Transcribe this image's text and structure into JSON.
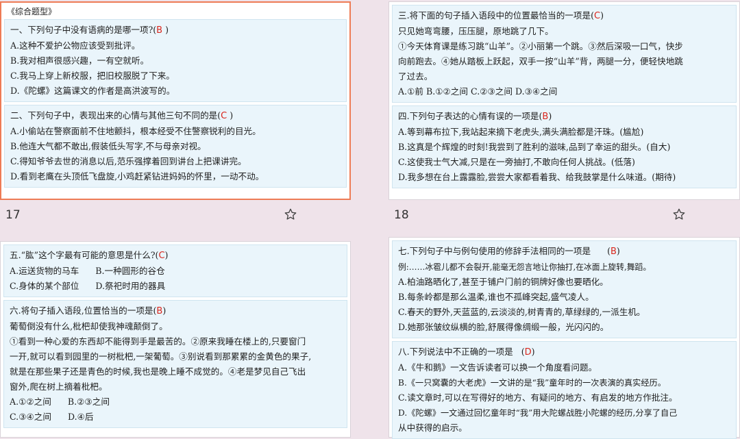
{
  "card17": {
    "tag": "《综合题型》",
    "q1": {
      "stem": "一、下列句子中没有语病的是哪一项?(",
      "answer": "B",
      "close": " )",
      "options": [
        "A.这种不爱护公物应该受到批评。",
        "B.我对相声很感兴趣，一有空就听。",
        "C.我马上穿上新校服，把旧校服脱了下来。",
        "D.《陀螺》这篇课文的作者是高洪波写的。"
      ]
    },
    "q2": {
      "stem": "二、下列句子中，表现出来的心情与其他三句不同的是(",
      "answer": "C",
      "close": " )",
      "options": [
        "A.小偷站在警察面前不住地颤抖，根本经受不住警察锐利的目光。",
        "B.他连大气都不敢出,假装低头写字,不与母亲对视。",
        "C.得知爷爷去世的消息以后,范乐强撑着回到讲台上把课讲完。",
        "D.看到老鹰在头顶低飞盘旋,小鸡赶紧钻进妈妈的怀里，一动不动。"
      ]
    },
    "number": "17"
  },
  "card18": {
    "q3": {
      "stem": "三.将下面的句子插入语段中的位置最恰当的一项是(",
      "answer": "C",
      "close": ")",
      "passage": [
        "只见她弯弯腰，压压腿，原地跳了几下。",
        "①今天体育课是练习跳“山羊”。②小丽第一个跳。③然后深吸一口气，快步",
        "向前跑去。④她从踏板上跃起，双手一按“山羊”背，两腿一分，便轻快地跳",
        "了过去。"
      ],
      "choices": "A.①前   B.①②之间   C.②③之间   D.③④之间"
    },
    "q4": {
      "stem": "四.下列句子表达的心情有误的一项是(",
      "answer": "B",
      "close": ")",
      "options": [
        "A.等到幕布拉下,我站起来摘下老虎头,满头满脸都是汗珠。(尴尬)",
        "B.这真是个辉煌的时刻!我尝到了胜利的滋味,品到了幸运的甜头。(自大)",
        "C.这使我士气大减,只是在一旁抽打,不敢向任何人挑战。(低落)",
        "D.我多想在台上露露脸,尝尝大家都看着我、给我鼓掌是什么味道。(期待)"
      ]
    },
    "number": "18"
  },
  "card19": {
    "q5": {
      "stem": "五.“肱”这个字最有可能的意思是什么?(",
      "answer": "C",
      "close": ")",
      "options": [
        "A.运送货物的马车      B.一种圆形的谷仓",
        "C.身体的某个部位      D.祭祀时用的器具"
      ]
    },
    "q6": {
      "stem": "六.将句子插入语段,位置恰当的一项是(",
      "answer": "B",
      "close": ")",
      "insert": "葡萄倒没有什么,枇杷却使我神魂颠倒了。",
      "passage": [
        "①看到一种心爱的东西却不能得到手是最苦的。②原来我睡在楼上的,只要窗门",
        "一开,就可以看到园里的一树枇杷,一架葡萄。③别说看到那累累的金黄色的果子,",
        "就是在那些果子还是青色的时候,我也是晚上睡不成觉的。④老是梦见自己飞出",
        "窗外,爬在树上摘着枇杷。"
      ],
      "choices": [
        "A.①②之间      B.②③之间",
        "C.③④之间      D.④后"
      ]
    }
  },
  "card20": {
    "q7": {
      "stem": "七.下列句子中与例句使用的修辞手法相同的一项是      (",
      "answer": "B",
      "close": ")",
      "example": "例:……冰雹儿都不会裂开,能毫无怨言地让你抽打,在冰面上旋转,舞蹈。",
      "options": [
        "A.柏油路晒化了,甚至于铺户门前的铜牌好像也要晒化。",
        "B.每条岭都是那么温柔,谁也不孤峰突起,盛气凌人。",
        "C.春天的野外,天蓝蓝的,云淡淡的,树青青的,草绿绿的,一派生机。",
        "D.她那张皱纹纵横的脸,舒展得像绸缎一般，光闪闪的。"
      ]
    },
    "q8": {
      "stem": "八.下列说法中不正确的一项是   (",
      "answer": "D",
      "close": ")",
      "options": [
        "A.《牛和鹅》一文告诉读者可以换一个角度看问题。",
        "B.《一只窝囊的大老虎》一文讲的是“我”童年时的一次表演的真实经历。",
        "C.读文章时,可以在写得好的地方、有疑问的地方、有启发的地方作批注。",
        "D.《陀螺》一文通过回忆童年时“我”用大陀螺战胜小陀螺的经历,分享了自己",
        "从中获得的启示。"
      ]
    }
  },
  "icons": {
    "star": "star-outline-icon"
  },
  "colors": {
    "answer": "#d9261c",
    "selected_border": "#ee7b55",
    "block_bg": "#eaf5fb",
    "page_bg": "#efe3ea"
  }
}
